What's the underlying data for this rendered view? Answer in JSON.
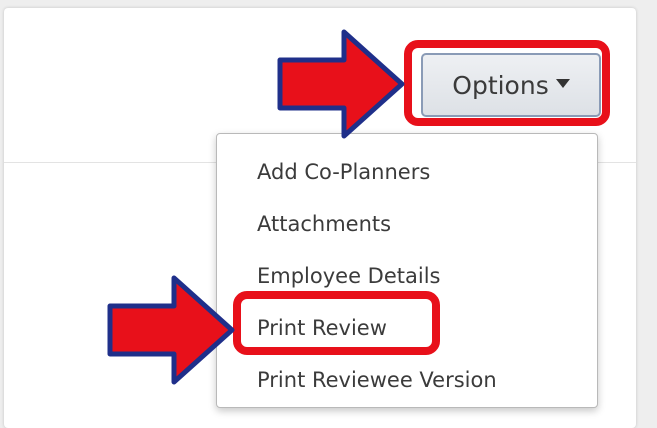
{
  "header": {
    "options_label": "Options"
  },
  "dropdown": {
    "items": [
      {
        "label": "Add Co-Planners"
      },
      {
        "label": "Attachments"
      },
      {
        "label": "Employee Details"
      },
      {
        "label": "Print Review"
      },
      {
        "label": "Print Reviewee Version"
      }
    ]
  },
  "annotations": {
    "highlight_color": "#e8101a",
    "arrow_fill": "#e8101a",
    "arrow_outline": "#1f2f8a"
  },
  "icons": {
    "options_caret": "caret-down-icon",
    "arrow": "arrow-right-icon"
  }
}
